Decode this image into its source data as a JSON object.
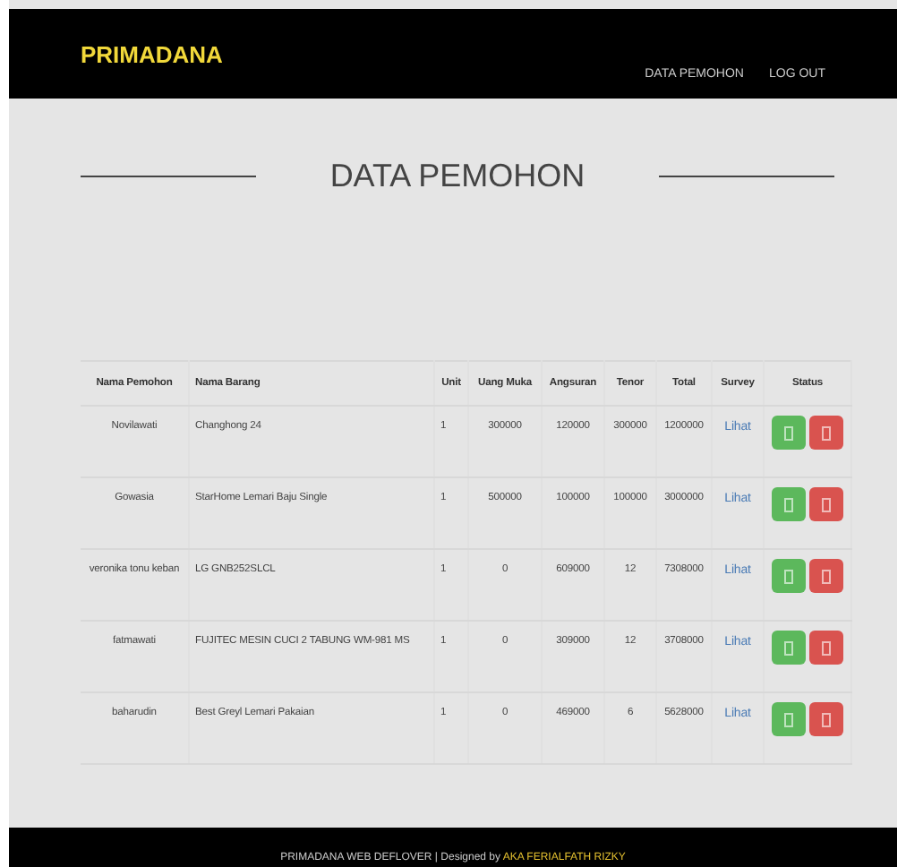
{
  "navbar": {
    "brand": "PRIMADANA",
    "links": [
      "DATA PEMOHON",
      "LOG OUT"
    ]
  },
  "page": {
    "title": "DATA PEMOHON"
  },
  "table": {
    "columns": [
      "Nama Pemohon",
      "Nama Barang",
      "Unit",
      "Uang Muka",
      "Angsuran",
      "Tenor",
      "Total",
      "Survey",
      "Status"
    ],
    "rows": [
      {
        "nama_pemohon": "Novilawati",
        "nama_barang": "Changhong 24",
        "unit": "1",
        "uang_muka": "300000",
        "angsuran": "120000",
        "tenor": "300000",
        "total": "1200000",
        "survey": "Lihat"
      },
      {
        "nama_pemohon": "Gowasia",
        "nama_barang": "StarHome Lemari Baju Single",
        "unit": "1",
        "uang_muka": "500000",
        "angsuran": "100000",
        "tenor": "100000",
        "total": "3000000",
        "survey": "Lihat"
      },
      {
        "nama_pemohon": "veronika tonu keban",
        "nama_barang": "LG GNB252SLCL",
        "unit": "1",
        "uang_muka": "0",
        "angsuran": "609000",
        "tenor": "12",
        "total": "7308000",
        "survey": "Lihat"
      },
      {
        "nama_pemohon": "fatmawati",
        "nama_barang": "FUJITEC MESIN CUCI 2 TABUNG WM-981 MS",
        "unit": "1",
        "uang_muka": "0",
        "angsuran": "309000",
        "tenor": "12",
        "total": "3708000",
        "survey": "Lihat"
      },
      {
        "nama_pemohon": "baharudin",
        "nama_barang": "Best Greyl Lemari Pakaian",
        "unit": "1",
        "uang_muka": "0",
        "angsuran": "469000",
        "tenor": "6",
        "total": "5628000",
        "survey": "Lihat"
      }
    ]
  },
  "footer": {
    "text": "PRIMADANA WEB DEFLOVER | Designed by",
    "author": "AKA FERIALFATH RIZKY"
  }
}
